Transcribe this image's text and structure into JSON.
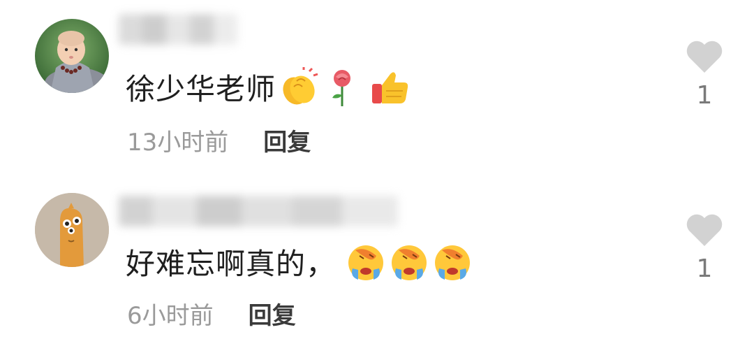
{
  "comments": [
    {
      "text": "徐少华老师",
      "emojis": [
        "clapping-hands",
        "rose",
        "thumbs-up"
      ],
      "time": "13小时前",
      "reply_label": "回复",
      "like_count": "1"
    },
    {
      "text": "好难忘啊真的，",
      "emojis": [
        "facepalm-crying",
        "facepalm-crying",
        "facepalm-crying"
      ],
      "time": "6小时前",
      "reply_label": "回复",
      "like_count": "1"
    }
  ],
  "colors": {
    "heart": "#d2d2d2",
    "time_text": "#9a9a9a",
    "comment_text": "#1f1f1f"
  }
}
